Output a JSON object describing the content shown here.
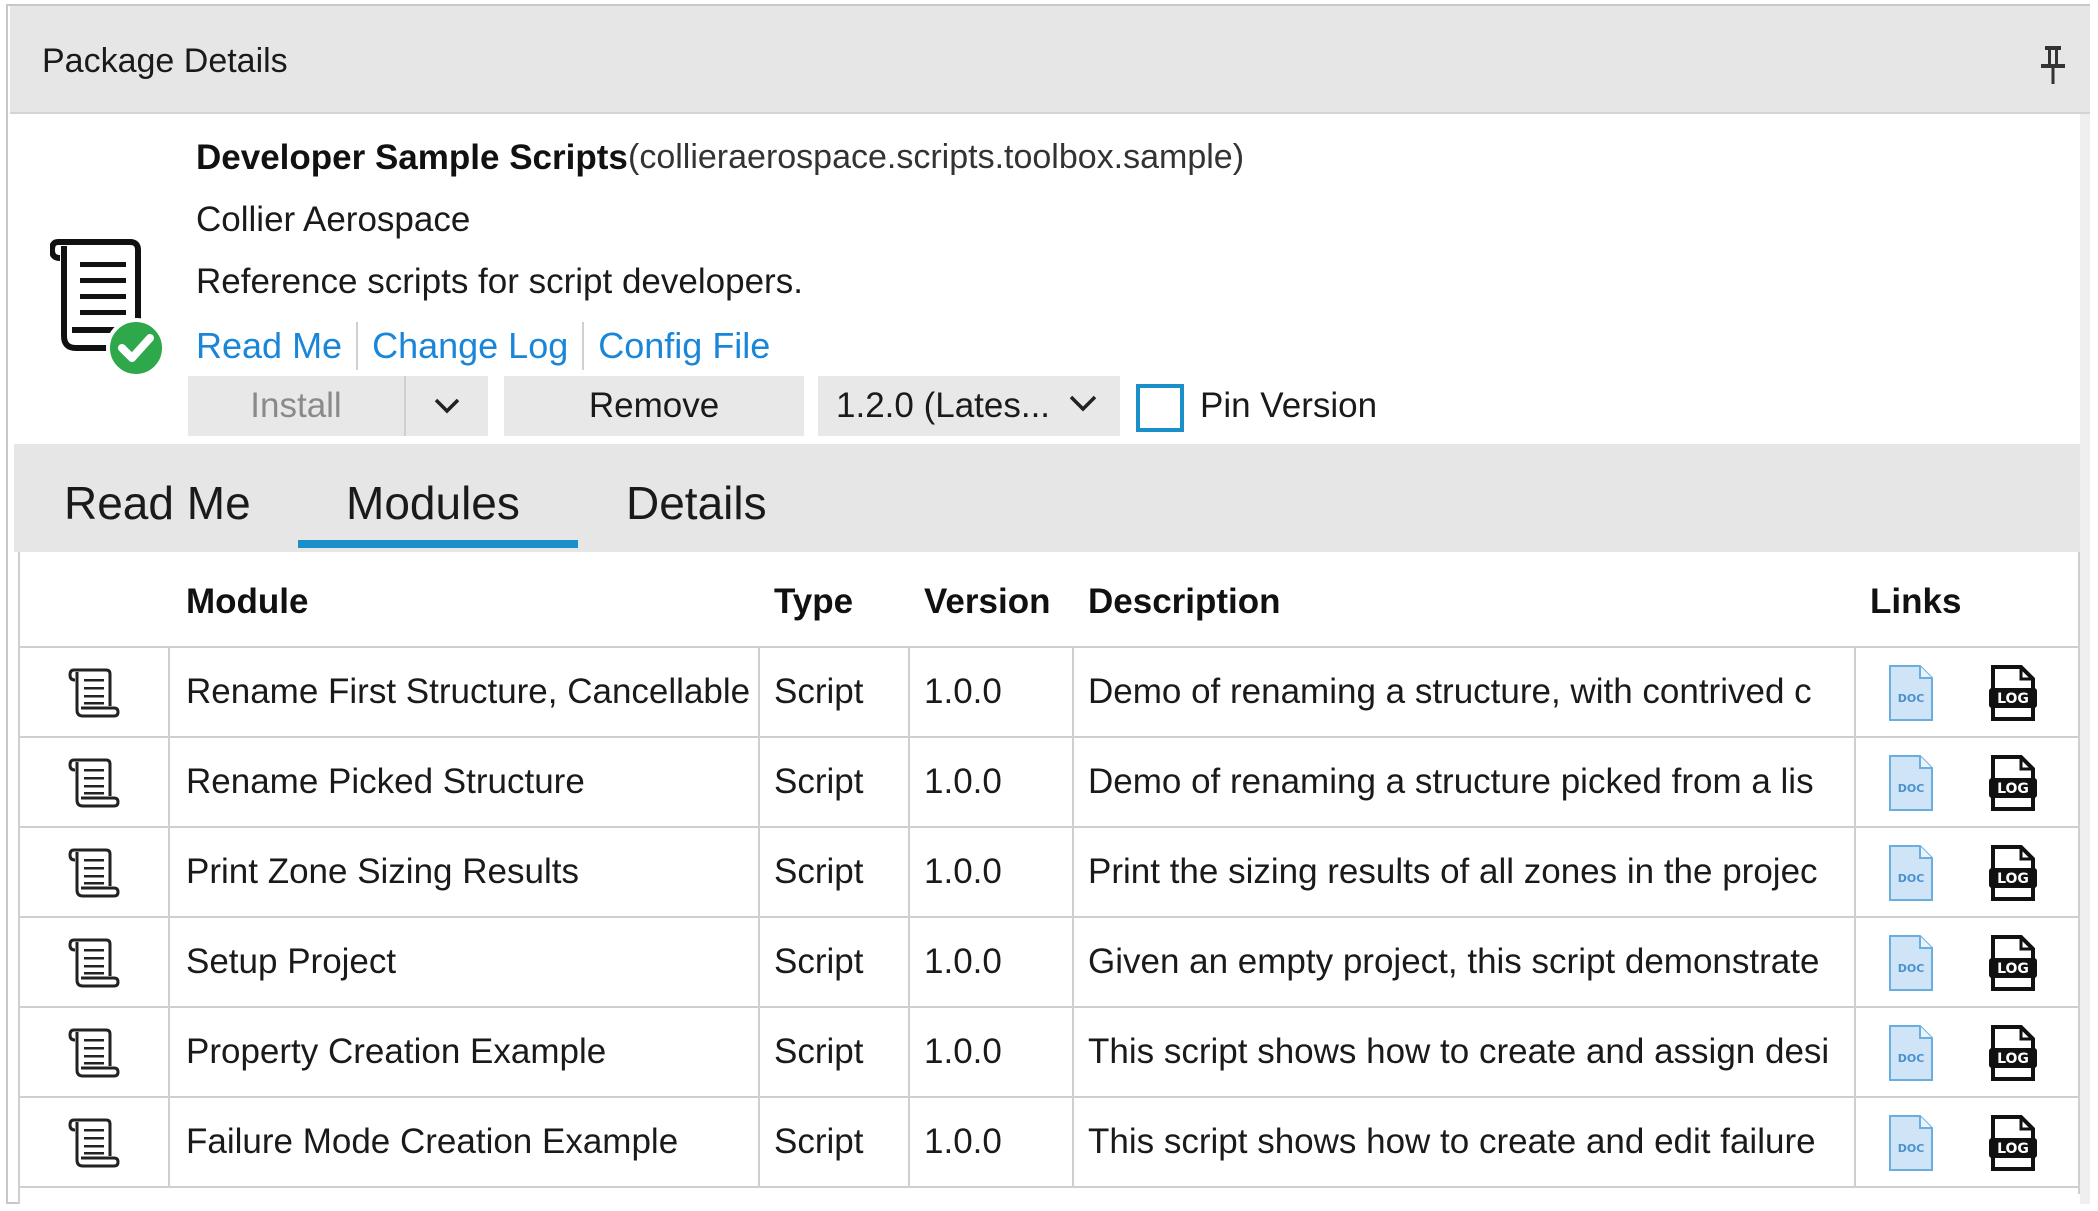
{
  "panel": {
    "title": "Package Details",
    "pin_icon": "pushpin-icon"
  },
  "package": {
    "name": "Developer Sample Scripts",
    "id": "(collieraerospace.scripts.toolbox.sample)",
    "author": "Collier Aerospace",
    "description": "Reference scripts for script developers.",
    "icon": "script-scroll-icon",
    "status_icon": "installed-check-icon",
    "links": {
      "read_me": "Read Me",
      "change_log": "Change Log",
      "config_file": "Config File"
    }
  },
  "actions": {
    "install_label": "Install",
    "remove_label": "Remove",
    "version_value": "1.2.0 (Lates...",
    "pin_version_label": "Pin Version",
    "pin_version_checked": false
  },
  "tabs": {
    "read_me": "Read Me",
    "modules": "Modules",
    "details": "Details",
    "active": "Modules"
  },
  "table": {
    "headers": {
      "module": "Module",
      "type": "Type",
      "version": "Version",
      "description": "Description",
      "links": "Links"
    },
    "rows": [
      {
        "module": "Rename First Structure, Cancellable",
        "type": "Script",
        "version": "1.0.0",
        "description": "Demo of renaming a structure, with contrived c"
      },
      {
        "module": "Rename Picked Structure",
        "type": "Script",
        "version": "1.0.0",
        "description": "Demo of renaming a structure picked from a lis"
      },
      {
        "module": "Print Zone Sizing Results",
        "type": "Script",
        "version": "1.0.0",
        "description": "Print the sizing results of all zones in the projec"
      },
      {
        "module": "Setup Project",
        "type": "Script",
        "version": "1.0.0",
        "description": "Given an empty project, this script demonstrate"
      },
      {
        "module": "Property Creation Example",
        "type": "Script",
        "version": "1.0.0",
        "description": "This script shows how to create and assign desi"
      },
      {
        "module": "Failure Mode Creation Example",
        "type": "Script",
        "version": "1.0.0",
        "description": "This script shows how to create and edit failure"
      }
    ],
    "link_icons": [
      "doc-file-icon",
      "log-file-icon"
    ]
  },
  "colors": {
    "accent": "#1a8fc8",
    "link": "#1a86d9",
    "check_green": "#2ea84a",
    "header_bg": "#e6e6e6"
  }
}
